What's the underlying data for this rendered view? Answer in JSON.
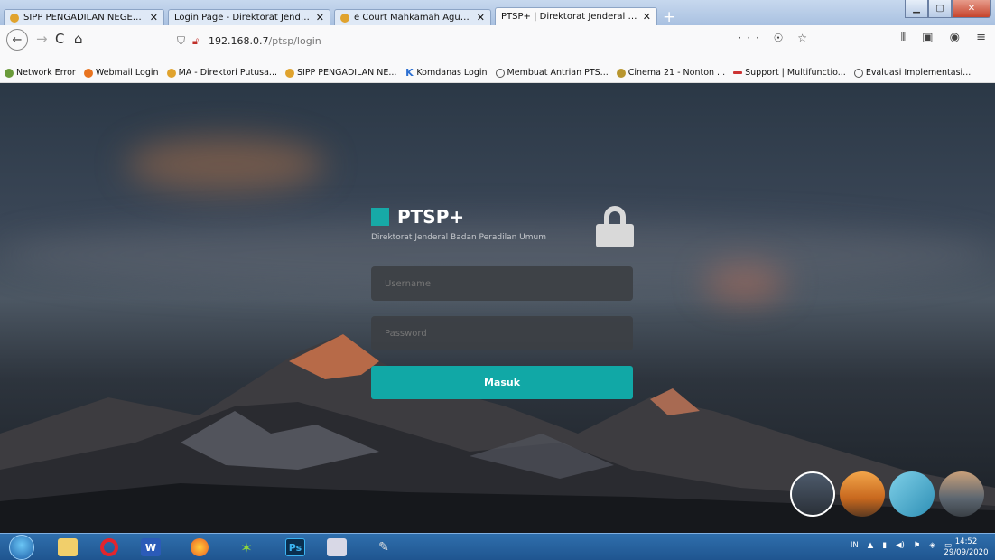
{
  "browser": {
    "tabs": [
      {
        "label": "SIPP PENGADILAN NEGERI TA"
      },
      {
        "label": "Login Page - Direktorat Jenderal Ba"
      },
      {
        "label": "e Court Mahkamah Agung RI |"
      },
      {
        "label": "PTSP+ | Direktorat Jenderal Badan P"
      }
    ],
    "new_tab": "+",
    "url_host": "192.168.0.7",
    "url_path": "/ptsp/login",
    "url_actions": "··· ☉ ☆",
    "bookmarks": [
      {
        "label": "Network Error",
        "color": "#6a9b3a"
      },
      {
        "label": "Webmail Login",
        "color": "#e8731f"
      },
      {
        "label": "MA - Direktori Putusa...",
        "color": "#e0a32e"
      },
      {
        "label": "SIPP PENGADILAN NE...",
        "color": "#e0a32e"
      },
      {
        "label": "Komdanas Login",
        "color": "#2c6fd1"
      },
      {
        "label": "Membuat Antrian PTS...",
        "color": "#555555"
      },
      {
        "label": "Cinema 21 - Nonton ...",
        "color": "#b8962f"
      },
      {
        "label": "Support | Multifunctio...",
        "color": "#cc3333"
      },
      {
        "label": "Evaluasi Implementasi...",
        "color": "#555555"
      }
    ]
  },
  "login": {
    "brand_title": "PTSP+",
    "brand_subtitle": "Direktorat Jenderal Badan Peradilan Umum",
    "username_placeholder": "Username",
    "password_placeholder": "Password",
    "submit_label": "Masuk"
  },
  "taskbar": {
    "apps": [
      "explorer",
      "opera",
      "word",
      "firefox",
      "app",
      "photoshop",
      "paint",
      "tool"
    ],
    "word_letter": "W",
    "ps_letter": "Ps",
    "tray_lang": "IN",
    "time": "14:52",
    "date": "29/09/2020"
  },
  "colors": {
    "accent": "#11a8a6",
    "input_bg": "#3c3f44"
  }
}
